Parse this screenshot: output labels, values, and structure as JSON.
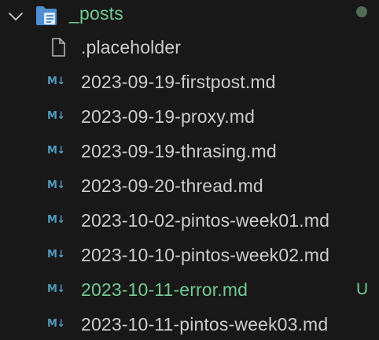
{
  "colors": {
    "background": "#181818",
    "text": "#cccccc",
    "muted": "#b5b5b5",
    "untracked": "#73c991",
    "markdown_icon": "#519aba",
    "folder_icon": "#4d8fd1",
    "dot": "#4f6a57"
  },
  "folder": {
    "label": "_posts",
    "icon": "folder-open-icon",
    "chevron": "chevron-down-icon",
    "expanded": true
  },
  "files": [
    {
      "name": ".placeholder",
      "icon": "file-icon",
      "status": ""
    },
    {
      "name": "2023-09-19-firstpost.md",
      "icon": "markdown-icon",
      "icon_text": "M↓",
      "status": ""
    },
    {
      "name": "2023-09-19-proxy.md",
      "icon": "markdown-icon",
      "icon_text": "M↓",
      "status": ""
    },
    {
      "name": "2023-09-19-thrasing.md",
      "icon": "markdown-icon",
      "icon_text": "M↓",
      "status": ""
    },
    {
      "name": "2023-09-20-thread.md",
      "icon": "markdown-icon",
      "icon_text": "M↓",
      "status": ""
    },
    {
      "name": "2023-10-02-pintos-week01.md",
      "icon": "markdown-icon",
      "icon_text": "M↓",
      "status": ""
    },
    {
      "name": "2023-10-10-pintos-week02.md",
      "icon": "markdown-icon",
      "icon_text": "M↓",
      "status": ""
    },
    {
      "name": "2023-10-11-error.md",
      "icon": "markdown-icon",
      "icon_text": "M↓",
      "status": "U"
    },
    {
      "name": "2023-10-11-pintos-week03.md",
      "icon": "markdown-icon",
      "icon_text": "M↓",
      "status": ""
    }
  ]
}
